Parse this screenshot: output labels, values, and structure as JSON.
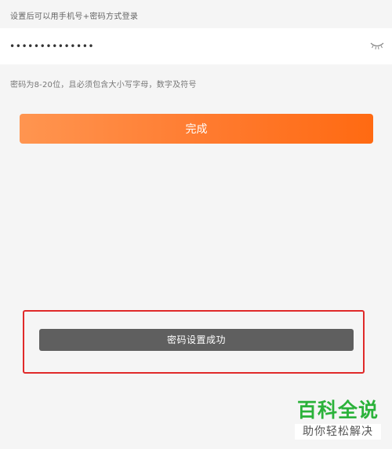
{
  "hint_top": "设置后可以用手机号+密码方式登录",
  "password": {
    "value": "••••••••••••••",
    "icon": "eye-closed-icon"
  },
  "rule_text": "密码为8-20位，且必须包含大小写字母，数字及符号",
  "finish_button": {
    "label": "完成"
  },
  "toast": {
    "message": "密码设置成功"
  },
  "watermark": {
    "title": "百科全说",
    "subtitle": "助你轻松解决"
  },
  "colors": {
    "accent_start": "#ff9550",
    "accent_end": "#ff6a12",
    "highlight": "#e02a2a",
    "toast_bg": "#5f5f5f",
    "watermark_green": "#2bb23a"
  }
}
